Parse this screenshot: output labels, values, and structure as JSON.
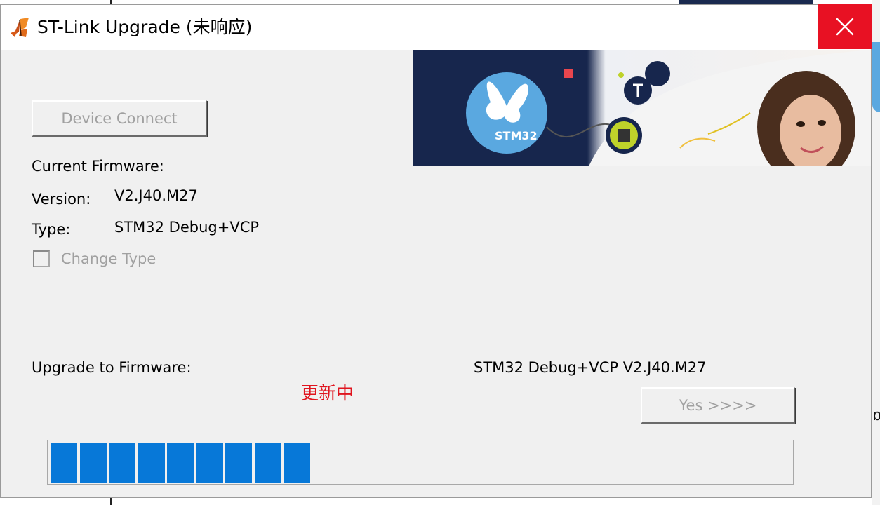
{
  "window": {
    "title": "ST-Link Upgrade (未响应)",
    "close_icon": "close-icon"
  },
  "banner": {
    "chip_label": "STM32"
  },
  "buttons": {
    "device_connect": "Device Connect",
    "yes": "Yes >>>>"
  },
  "current": {
    "heading": "Current Firmware:",
    "version_label": "Version:",
    "version_value": "V2.J40.M27",
    "type_label": "Type:",
    "type_value": "STM32 Debug+VCP",
    "change_type_label": "Change Type",
    "change_type_checked": false
  },
  "upgrade": {
    "label": "Upgrade to Firmware:",
    "target": "STM32 Debug+VCP  V2.J40.M27",
    "status": "更新中"
  },
  "progress": {
    "segments_filled": 9,
    "fraction": 0.35,
    "color": "#0778d8"
  },
  "colors": {
    "close_red": "#e81123",
    "status_red": "#e0141e",
    "banner_navy": "#17264d",
    "stm_blue": "#5aa8e0"
  }
}
